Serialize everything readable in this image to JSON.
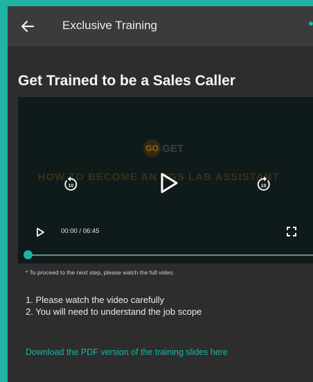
{
  "appbar": {
    "title": "Exclusive Training",
    "back_icon": "arrow-left-icon"
  },
  "page": {
    "title": "Get Trained to be a Sales Caller"
  },
  "video": {
    "logo_text_left": "GO",
    "logo_text_right": "GET",
    "caption": "HOW TO BECOME AN SGS LAB ASSISTANT",
    "time": "00:00 / 06:45",
    "rewind_icon": "rewind-10-icon",
    "forward_icon": "forward-10-icon",
    "play_icon": "play-icon",
    "fullscreen_icon": "fullscreen-icon",
    "progress": 0,
    "rewind_seconds": "10",
    "forward_seconds": "10"
  },
  "notice": "* To proceed to the next step, please watch the full video.",
  "instructions": [
    "1. Please watch the video carefully",
    "2. You will need to understand the job scope"
  ],
  "pdf_link": "Download the PDF version of the training slides here",
  "colors": {
    "accent": "#1fb3a4",
    "background": "#2d2d2d",
    "appbar": "#3b3b3b",
    "video": "#0f1a1b"
  }
}
